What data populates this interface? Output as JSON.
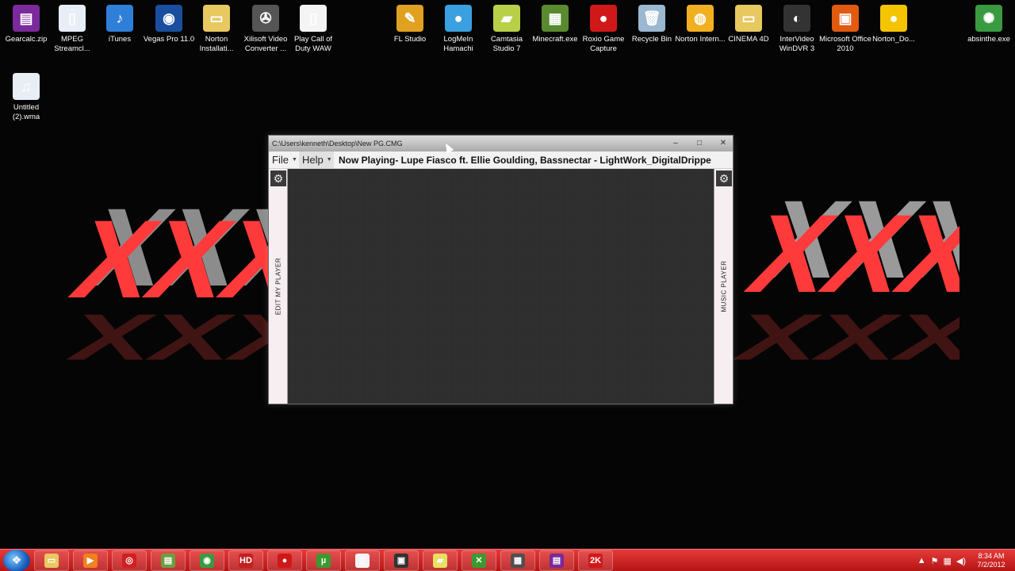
{
  "desktop_icons": [
    {
      "label": "Gearcalc.zip",
      "icon": "winrar-archive-icon",
      "color": "#7a2a9a",
      "glyph": "▤"
    },
    {
      "label": "MPEG Streamcl...",
      "icon": "document-icon",
      "color": "#e8eef6",
      "glyph": "▯"
    },
    {
      "label": "iTunes",
      "icon": "itunes-icon",
      "color": "#2f7fd8",
      "glyph": "♪"
    },
    {
      "label": "Vegas Pro 11.0",
      "icon": "vegas-pro-icon",
      "color": "#1a4fa0",
      "glyph": "◉"
    },
    {
      "label": "Norton Installati...",
      "icon": "folder-icon",
      "color": "#e8c860",
      "glyph": "▭"
    },
    {
      "label": "Xilisoft Video Converter ...",
      "icon": "film-reel-icon",
      "color": "#555555",
      "glyph": "✇"
    },
    {
      "label": "Play Call of Duty WAW",
      "icon": "document-icon",
      "color": "#f4f4f4",
      "glyph": "▯"
    },
    {
      "label": "FL Studio",
      "icon": "fl-studio-icon",
      "color": "#e0a020",
      "glyph": "✎"
    },
    {
      "label": "LogMeIn Hamachi",
      "icon": "hamachi-icon",
      "color": "#3aa0e0",
      "glyph": "●"
    },
    {
      "label": "Camtasia Studio 7",
      "icon": "camtasia-icon",
      "color": "#b8d048",
      "glyph": "▰"
    },
    {
      "label": "Minecraft.exe",
      "icon": "minecraft-icon",
      "color": "#5a8a30",
      "glyph": "▦"
    },
    {
      "label": "Roxio Game Capture",
      "icon": "record-icon",
      "color": "#d01818",
      "glyph": "●"
    },
    {
      "label": "Recycle Bin",
      "icon": "recycle-bin-icon",
      "color": "#9ab8d0",
      "glyph": "🗑"
    },
    {
      "label": "Norton Intern...",
      "icon": "norton-globe-icon",
      "color": "#f0b020",
      "glyph": "◍"
    },
    {
      "label": "CINEMA 4D",
      "icon": "folder-icon",
      "color": "#e8c860",
      "glyph": "▭"
    },
    {
      "label": "InterVideo WinDVR 3",
      "icon": "windvr-icon",
      "color": "#333333",
      "glyph": "◐"
    },
    {
      "label": "Microsoft Office 2010",
      "icon": "office-icon",
      "color": "#e05a10",
      "glyph": "▣"
    },
    {
      "label": "Norton_Do...",
      "icon": "norton-icon",
      "color": "#f5c400",
      "glyph": "●"
    },
    {
      "label": "absinthe.exe",
      "icon": "absinthe-icon",
      "color": "#3a9a40",
      "glyph": "✺"
    },
    {
      "label": "Untitled (2).wma",
      "icon": "audio-file-icon",
      "color": "#e8eef6",
      "glyph": "♫"
    }
  ],
  "window": {
    "title": "C:\\Users\\kenneth\\Desktop\\New PG.CMG",
    "minimize": "–",
    "maximize": "□",
    "close": "✕",
    "menu_file": "File",
    "menu_help": "Help",
    "now_playing": "Now Playing- Lupe Fiasco ft. Ellie Goulding, Bassnectar - LightWork_DigitalDrippe",
    "left_panel_label": "EDIT MY PLAYER",
    "right_panel_label": "MUSIC PLAYER",
    "gear_glyph": "⚙"
  },
  "taskbar": {
    "items": [
      {
        "icon": "windows-explorer-icon",
        "color": "#e8c860",
        "glyph": "▭"
      },
      {
        "icon": "media-player-icon",
        "color": "#f08020",
        "glyph": "▶"
      },
      {
        "icon": "search-magnifier-icon",
        "color": "#d02020",
        "glyph": "◎"
      },
      {
        "icon": "notepad-icon",
        "color": "#6aa040",
        "glyph": "▤"
      },
      {
        "icon": "chrome-icon",
        "color": "#3a9a40",
        "glyph": "◉"
      },
      {
        "icon": "hd-icon",
        "color": "#c02020",
        "glyph": "HD"
      },
      {
        "icon": "record-icon",
        "color": "#d01818",
        "glyph": "●"
      },
      {
        "icon": "utorrent-icon",
        "color": "#3a9a30",
        "glyph": "µ"
      },
      {
        "icon": "document-icon",
        "color": "#f4f4f4",
        "glyph": "▯"
      },
      {
        "icon": "camera-icon",
        "color": "#333333",
        "glyph": "▣"
      },
      {
        "icon": "sticky-notes-icon",
        "color": "#e8e060",
        "glyph": "▰"
      },
      {
        "icon": "xbox-icon",
        "color": "#3a9a30",
        "glyph": "✕"
      },
      {
        "icon": "game-icon",
        "color": "#505050",
        "glyph": "▦"
      },
      {
        "icon": "winrar-icon",
        "color": "#7a2a9a",
        "glyph": "▤"
      },
      {
        "icon": "game-2k-icon",
        "color": "#d01818",
        "glyph": "2K"
      }
    ],
    "time": "8:34 AM",
    "date": "7/2/2012"
  }
}
